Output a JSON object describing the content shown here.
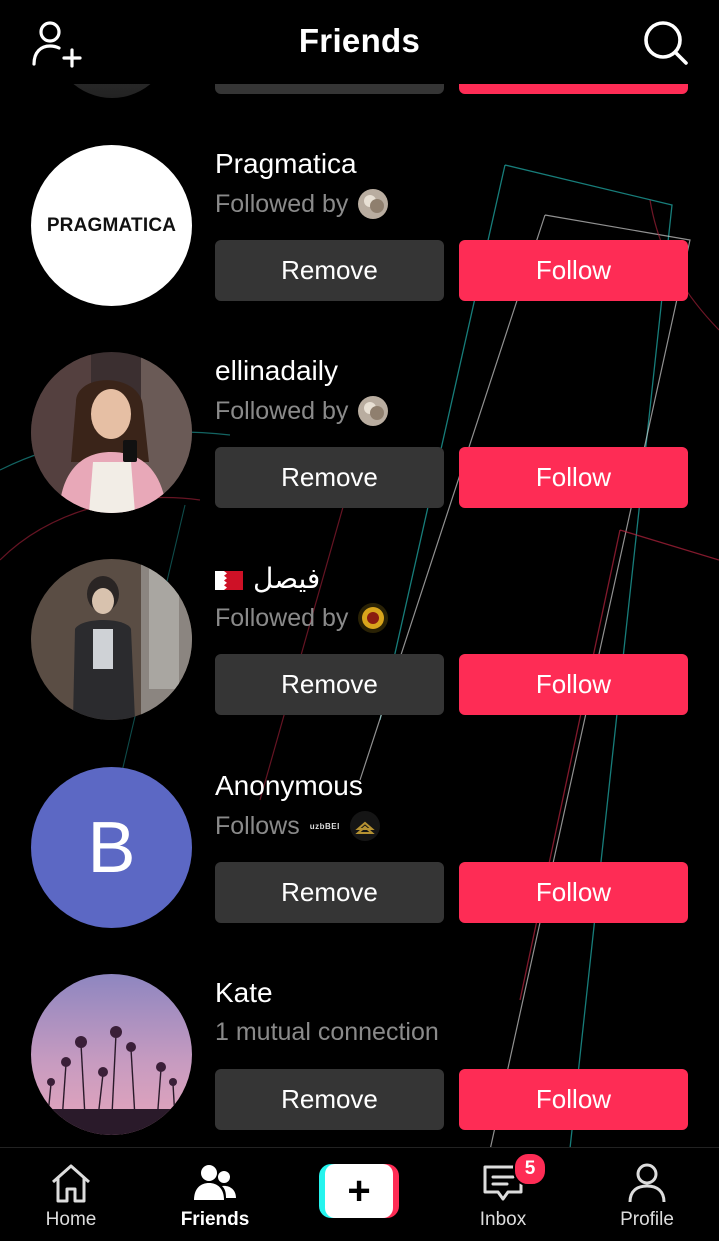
{
  "header": {
    "title": "Friends",
    "add_friend_icon": "add-user-icon",
    "search_icon": "search-icon"
  },
  "rows": [
    {
      "username": "Pragmatica",
      "avatar_text": "PRAGMATICA",
      "subline": "Followed by",
      "remove_label": "Remove",
      "follow_label": "Follow"
    },
    {
      "username": "ellinadaily",
      "subline": "Followed by",
      "remove_label": "Remove",
      "follow_label": "Follow"
    },
    {
      "username": "فيصل",
      "flag": "bahrain-flag-icon",
      "subline": "Followed by",
      "remove_label": "Remove",
      "follow_label": "Follow"
    },
    {
      "username": "Anonymous",
      "avatar_letter": "B",
      "subline": "Follows",
      "mini_tag": "uzbBEI",
      "remove_label": "Remove",
      "follow_label": "Follow"
    },
    {
      "username": "Kate",
      "subline": "1 mutual connection",
      "remove_label": "Remove",
      "follow_label": "Follow"
    }
  ],
  "nav": {
    "home": "Home",
    "friends": "Friends",
    "create": "+",
    "inbox": "Inbox",
    "inbox_badge": "5",
    "profile": "Profile"
  },
  "colors": {
    "follow_button": "#fe2c55",
    "remove_button": "#353535",
    "background": "#000000",
    "anonymous_avatar": "#5c68c4"
  }
}
